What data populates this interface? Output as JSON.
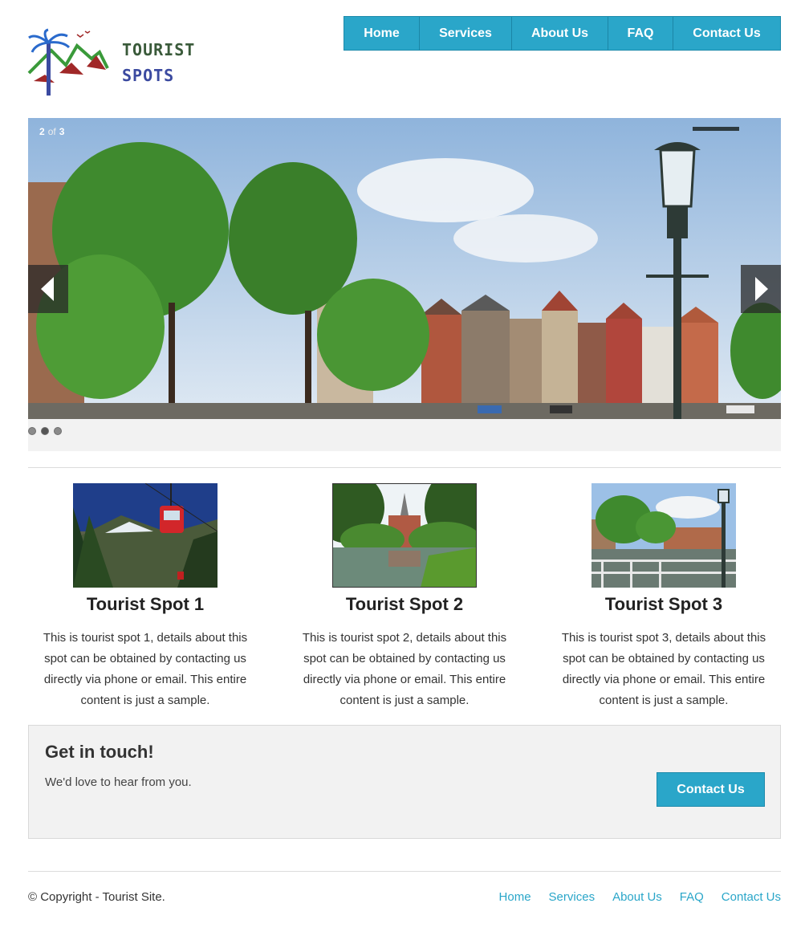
{
  "brand": {
    "logo_line1": "TOURIST",
    "logo_line2": "SPOTS",
    "logo_icon": "palm-mountain-logo"
  },
  "nav": {
    "items": [
      {
        "label": "Home"
      },
      {
        "label": "Services"
      },
      {
        "label": "About Us"
      },
      {
        "label": "FAQ"
      },
      {
        "label": "Contact Us"
      }
    ]
  },
  "slider": {
    "current": "2",
    "of": "of",
    "total": "3",
    "prev_icon": "chevron-left-icon",
    "next_icon": "chevron-right-icon",
    "dots": 3,
    "active_dot": 1
  },
  "spots": [
    {
      "title": "Tourist Spot 1",
      "text": "This is tourist spot 1, details about this spot can be obtained by contacting us directly via phone or email. This entire content is just a sample."
    },
    {
      "title": "Tourist Spot 2",
      "text": "This is tourist spot 2, details about this spot can be obtained by contacting us directly via phone or email. This entire content is just a sample."
    },
    {
      "title": "Tourist Spot 3",
      "text": "This is tourist spot 3, details about this spot can be obtained by contacting us directly via phone or email. This entire content is just a sample."
    }
  ],
  "touch": {
    "title": "Get in touch!",
    "text": "We'd love to hear from you.",
    "button": "Contact Us"
  },
  "footer": {
    "copyright": "© Copyright - Tourist Site.",
    "links": [
      {
        "label": "Home"
      },
      {
        "label": "Services"
      },
      {
        "label": "About Us"
      },
      {
        "label": "FAQ"
      },
      {
        "label": "Contact Us"
      }
    ]
  },
  "colors": {
    "accent": "#2aa6c9",
    "panel": "#f2f2f2",
    "text": "#333333"
  }
}
